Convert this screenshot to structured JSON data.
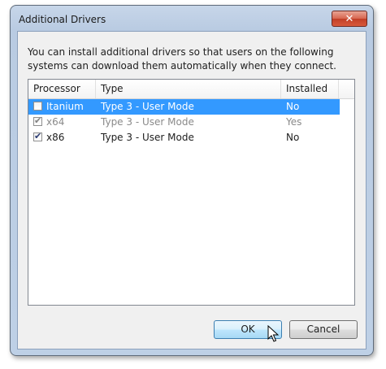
{
  "window": {
    "title": "Additional Drivers",
    "close_label": "✕"
  },
  "description": "You can install additional drivers so that users on the following systems can download them automatically when they connect.",
  "table": {
    "columns": [
      "Processor",
      "Type",
      "Installed"
    ],
    "rows": [
      {
        "processor": "Itanium",
        "type": "Type 3 - User Mode",
        "installed": "No",
        "checked": false,
        "selected": true,
        "disabled": false
      },
      {
        "processor": "x64",
        "type": "Type 3 - User Mode",
        "installed": "Yes",
        "checked": true,
        "selected": false,
        "disabled": true
      },
      {
        "processor": "x86",
        "type": "Type 3 - User Mode",
        "installed": "No",
        "checked": true,
        "selected": false,
        "disabled": false
      }
    ]
  },
  "buttons": {
    "ok": "OK",
    "cancel": "Cancel"
  },
  "colors": {
    "selection": "#3399ff",
    "close_button": "#c13f27"
  }
}
